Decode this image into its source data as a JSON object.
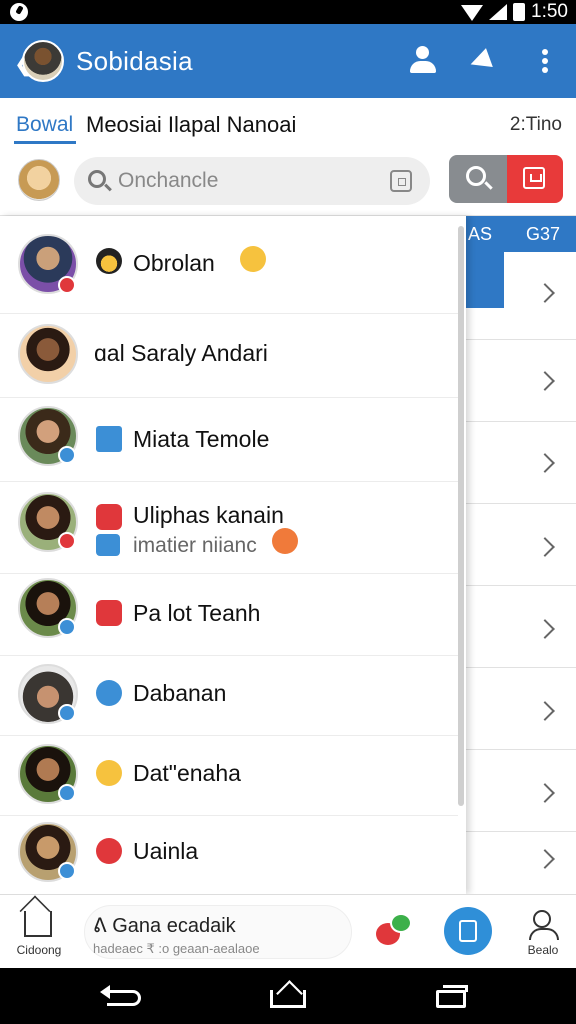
{
  "status_bar": {
    "time": "1:50"
  },
  "app_bar": {
    "title": "Sobidasia"
  },
  "tabs": {
    "active_label": "Bowal",
    "title": "Meosiai Ilapal Nanoai",
    "time": "2:Tino"
  },
  "search": {
    "placeholder": "Onchancle"
  },
  "right_pane": {
    "header_left": "AS",
    "header_right": "G37"
  },
  "contacts": [
    {
      "name": "Obrolan",
      "subtitle": "",
      "badge": "red",
      "icon_name": "cowboy-emoji-icon"
    },
    {
      "name": "ɑal Saraly Andari",
      "subtitle": "",
      "badge": "",
      "icon_name": ""
    },
    {
      "name": "Miata Temole",
      "subtitle": "",
      "badge": "blue",
      "icon_name": "check-box-icon"
    },
    {
      "name": "Uliphas kanain",
      "subtitle": "imatier niianc",
      "badge": "red",
      "icon_name": "red-app-icon"
    },
    {
      "name": "Pa lot Teanh",
      "subtitle": "",
      "badge": "blue",
      "icon_name": "bookmark-icon"
    },
    {
      "name": "Dabanan",
      "subtitle": "",
      "badge": "blue",
      "icon_name": "power-icon"
    },
    {
      "name": "Dat\"enaha",
      "subtitle": "",
      "badge": "blue",
      "icon_name": "smiley-emoji-icon"
    },
    {
      "name": "Uainla",
      "subtitle": "",
      "badge": "blue",
      "icon_name": "star-badge-icon"
    }
  ],
  "bottom_bar": {
    "home_label": "Cidoong",
    "composer_main": "ᕕ Gana ecadaik",
    "composer_sub": "hadeaec ₹ :o geaan-aealaoe",
    "profile_label": "Bealo"
  },
  "colors": {
    "primary": "#2f78c5",
    "danger": "#e83a3a",
    "badge_blue": "#3c8fd6",
    "badge_red": "#e0373b"
  }
}
